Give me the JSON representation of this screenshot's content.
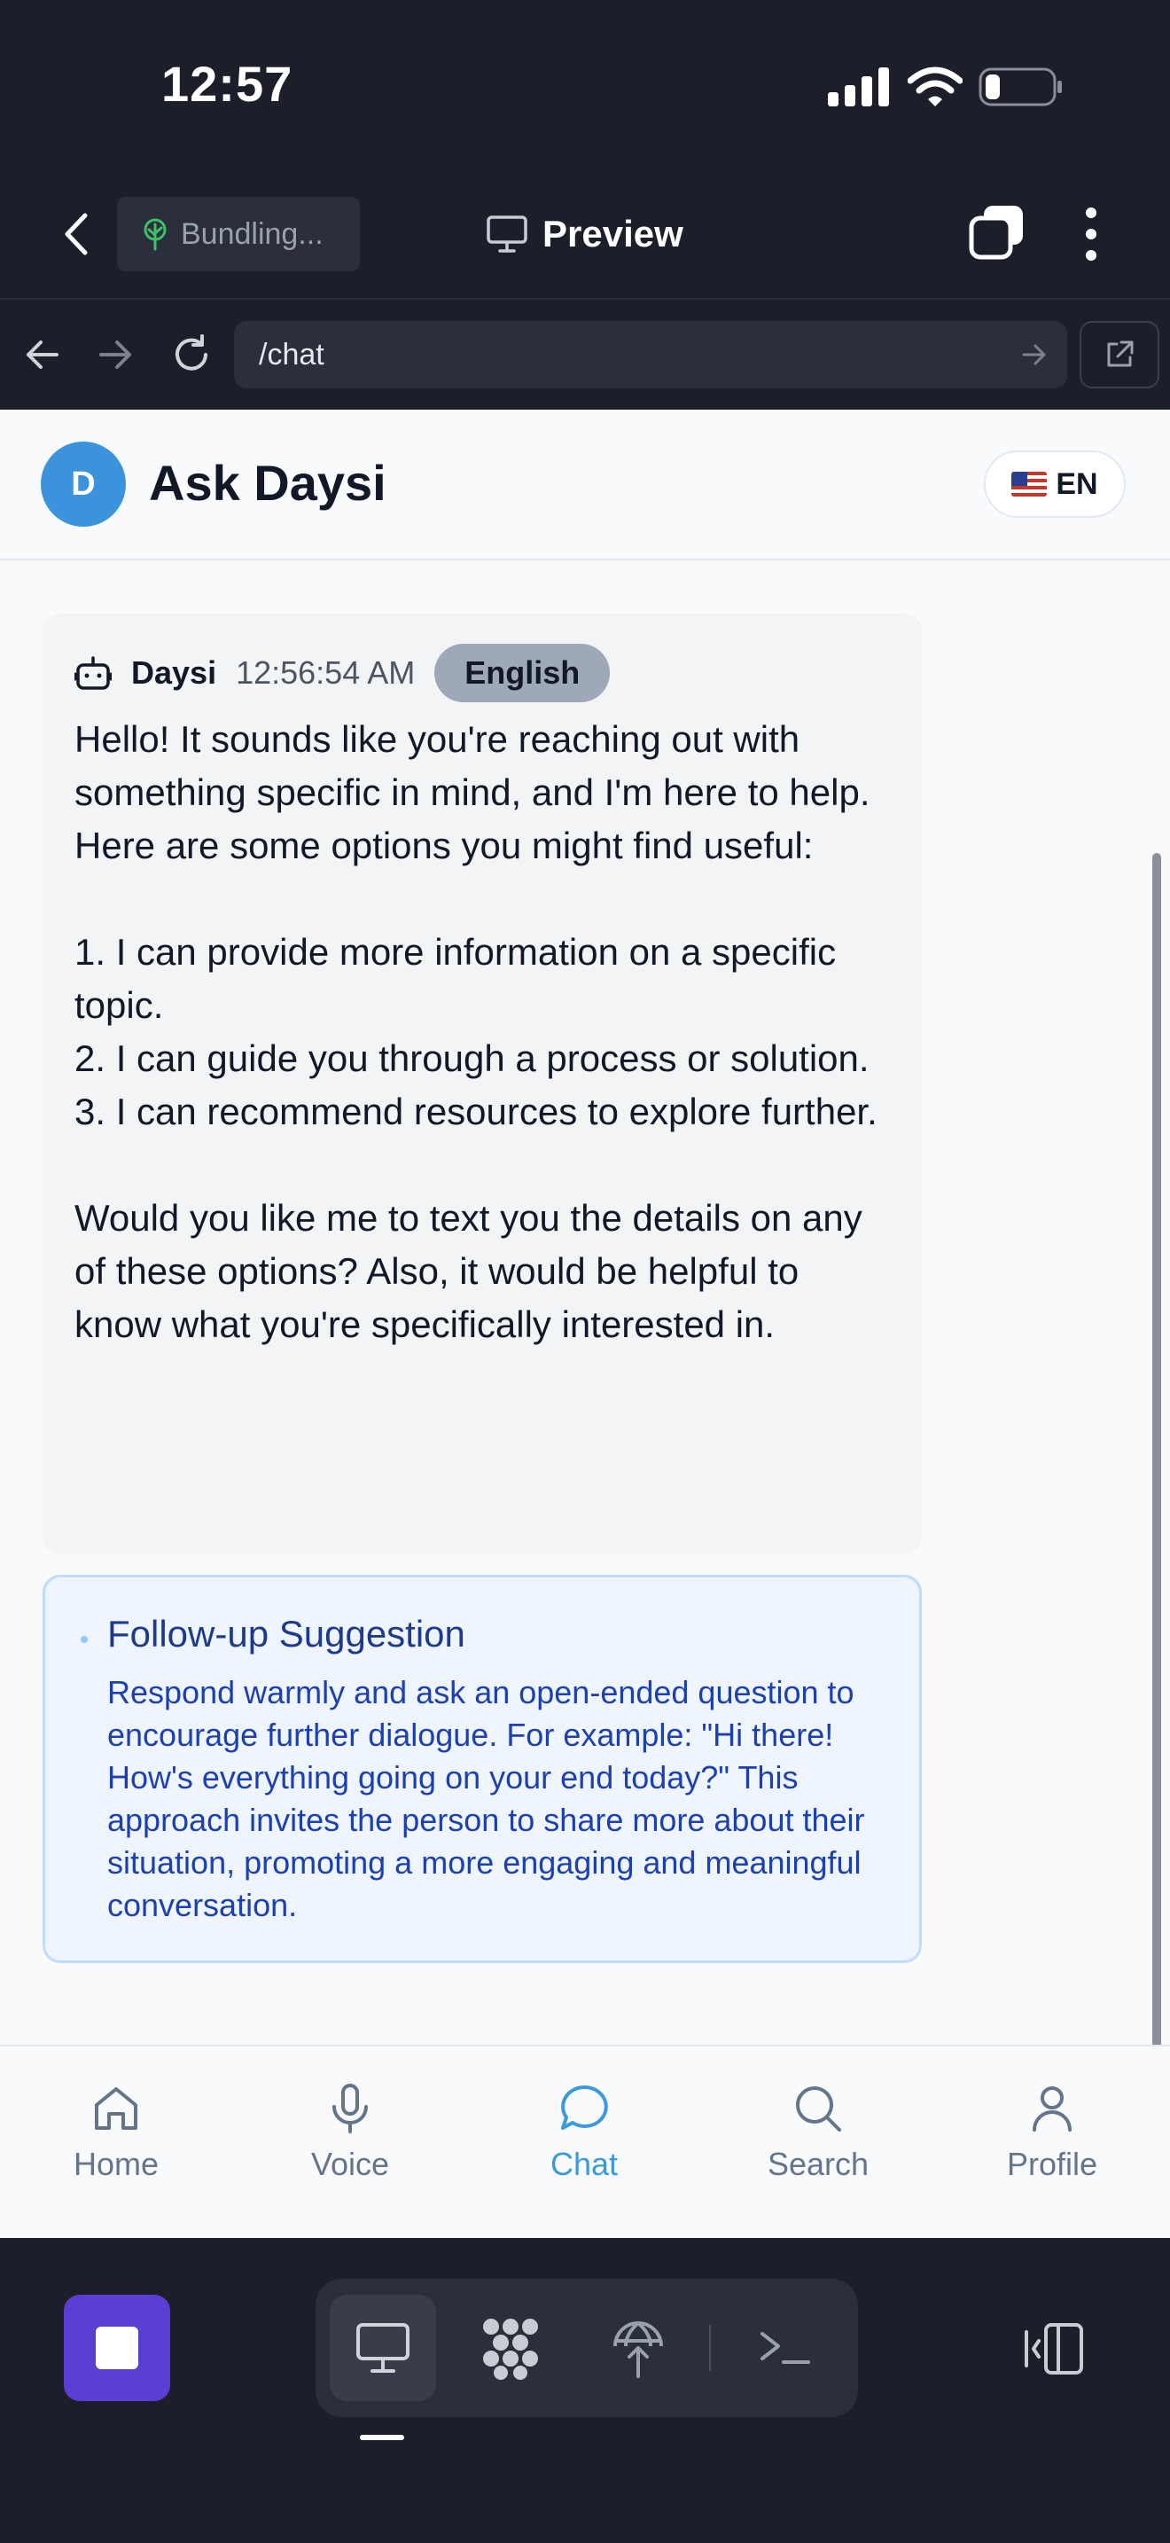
{
  "status_bar": {
    "time": "12:57"
  },
  "app_header": {
    "bundling_label": "Bundling...",
    "preview_label": "Preview"
  },
  "url_bar": {
    "value": "/chat"
  },
  "page": {
    "avatar_letter": "D",
    "title": "Ask Daysi",
    "language_toggle": "EN"
  },
  "message": {
    "sender": "Daysi",
    "time": "12:56:54 AM",
    "language": "English",
    "text": "Hello! It sounds like you're reaching out with something specific in mind, and I'm here to help. Here are some options you might find useful:\n\n1. I can provide more information on a specific topic.\n2. I can guide you through a process or solution.\n3. I can recommend resources to explore further.\n\nWould you like me to text you the details on any of these options? Also, it would be helpful to know what you're specifically interested in."
  },
  "suggestion": {
    "title": "Follow-up Suggestion",
    "text": "Respond warmly and ask an open-ended question to encourage further dialogue. For example: \"Hi there! How's everything going on your end today?\" This approach invites the person to share more about their situation, promoting a more engaging and meaningful conversation."
  },
  "bottom_nav": {
    "items": [
      {
        "label": "Home",
        "icon": "home-icon"
      },
      {
        "label": "Voice",
        "icon": "microphone-icon"
      },
      {
        "label": "Chat",
        "icon": "chat-bubble-icon",
        "active": true
      },
      {
        "label": "Search",
        "icon": "search-icon"
      },
      {
        "label": "Profile",
        "icon": "user-icon"
      }
    ]
  },
  "colors": {
    "chrome_bg": "#1c1f2a",
    "accent_active": "#3b9ad9",
    "stop_button": "#5b3dd1",
    "avatar": "#3b93dc"
  }
}
